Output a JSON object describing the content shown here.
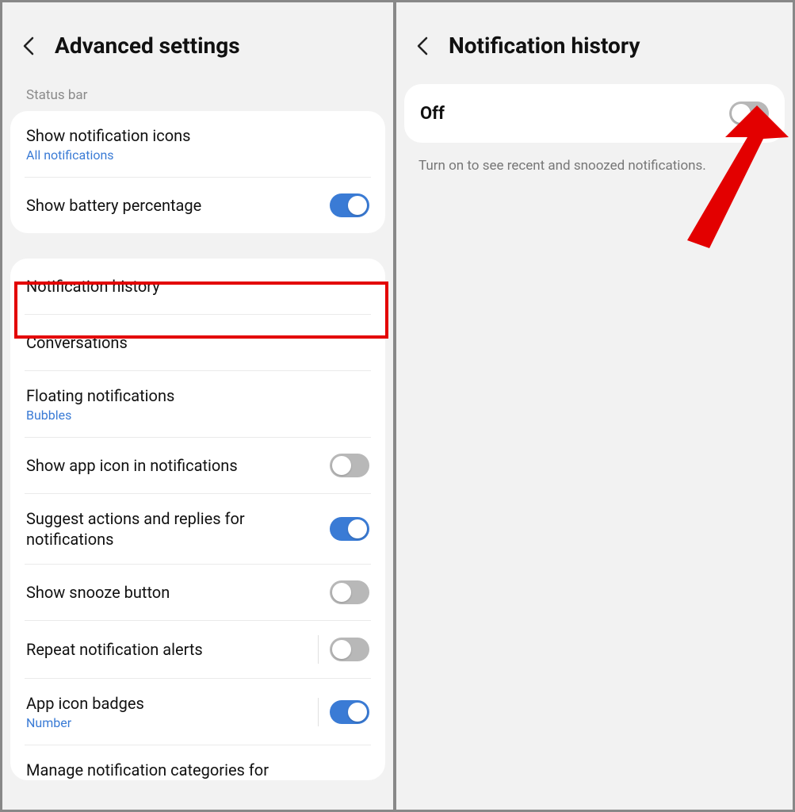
{
  "left": {
    "title": "Advanced settings",
    "section_label": "Status bar",
    "group1": {
      "show_notification_icons": {
        "title": "Show notification icons",
        "sub": "All notifications"
      },
      "show_battery_percentage": {
        "title": "Show battery percentage"
      }
    },
    "group2": {
      "notification_history": {
        "title": "Notification history"
      },
      "conversations": {
        "title": "Conversations"
      },
      "floating_notifications": {
        "title": "Floating notifications",
        "sub": "Bubbles"
      },
      "show_app_icon": {
        "title": "Show app icon in notifications"
      },
      "suggest_actions": {
        "title": "Suggest actions and replies for notifications"
      },
      "show_snooze": {
        "title": "Show snooze button"
      },
      "repeat_alerts": {
        "title": "Repeat notification alerts"
      },
      "app_icon_badges": {
        "title": "App icon badges",
        "sub": "Number"
      },
      "manage_cut": {
        "title": "Manage notification categories for"
      }
    }
  },
  "right": {
    "title": "Notification history",
    "state_label": "Off",
    "description": "Turn on to see recent and snoozed notifications."
  }
}
